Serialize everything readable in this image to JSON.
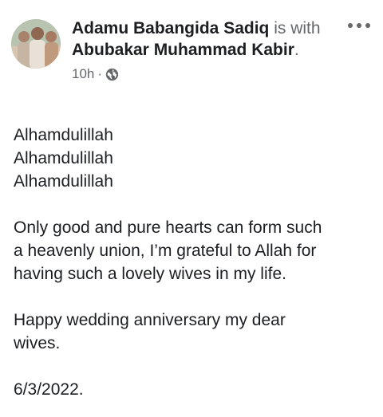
{
  "post": {
    "author": "Adamu Babangida Sadiq",
    "connector": "is with",
    "tagged": "Abubakar Muhammad Kabir",
    "terminator": ".",
    "timestamp": "10h",
    "separator": "·",
    "privacy_icon": "globe-icon",
    "more_icon": "more-horizontal-icon",
    "avatar_icon": "profile-photo",
    "body": {
      "line1": "Alhamdulillah",
      "line2": "Alhamdulillah",
      "line3": "Alhamdulillah",
      "paragraph1_line1": "Only good and pure hearts can form such",
      "paragraph1_line2": "a heavenly union, I’m grateful to Allah for",
      "paragraph1_line3": "having such a lovely wives in my life.",
      "paragraph2_line1": "Happy wedding anniversary my dear",
      "paragraph2_line2": "wives.",
      "date": "6/3/2022."
    }
  },
  "colors": {
    "text_primary": "#1c1e21",
    "text_secondary": "#65676b",
    "background": "#ffffff"
  }
}
